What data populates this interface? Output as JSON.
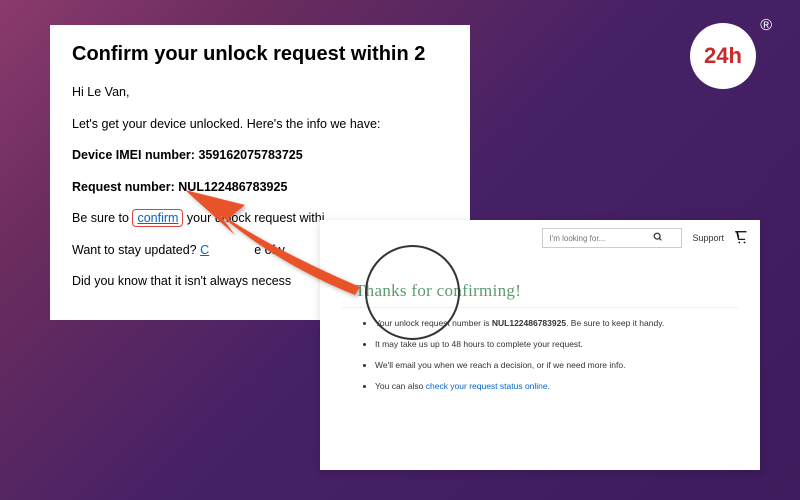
{
  "email": {
    "title": "Confirm your unlock request within 2",
    "greeting": "Hi Le Van,",
    "intro": "Let's get your device unlocked. Here's the info we have:",
    "imei_label": "Device IMEI number:",
    "imei_value": "359162075783725",
    "request_label": "Request number:",
    "request_value": "NUL122486783925",
    "confirm_prefix": "Be sure to ",
    "confirm_link": "confirm",
    "confirm_suffix": " your unlock request withi",
    "updated_prefix": "Want to stay updated? ",
    "updated_link": "C",
    "updated_suffix": "e of y",
    "footnote": "Did you know that it isn't always necess"
  },
  "confirm": {
    "search_placeholder": "I'm looking for...",
    "support_label": "Support",
    "thanks_title": "Thanks for confirming!",
    "bullets": {
      "b1_prefix": "Your unlock request number is ",
      "b1_num": "NUL122486783925",
      "b1_suffix": ". Be sure to keep it handy.",
      "b2": "It may take us up to 48 hours to complete your request.",
      "b3": "We'll email you when we reach a decision, or if we need more info.",
      "b4_prefix": "You can also ",
      "b4_link": "check your request status online",
      "b4_suffix": "."
    }
  },
  "logo": {
    "text": "24h",
    "registered": "®"
  }
}
